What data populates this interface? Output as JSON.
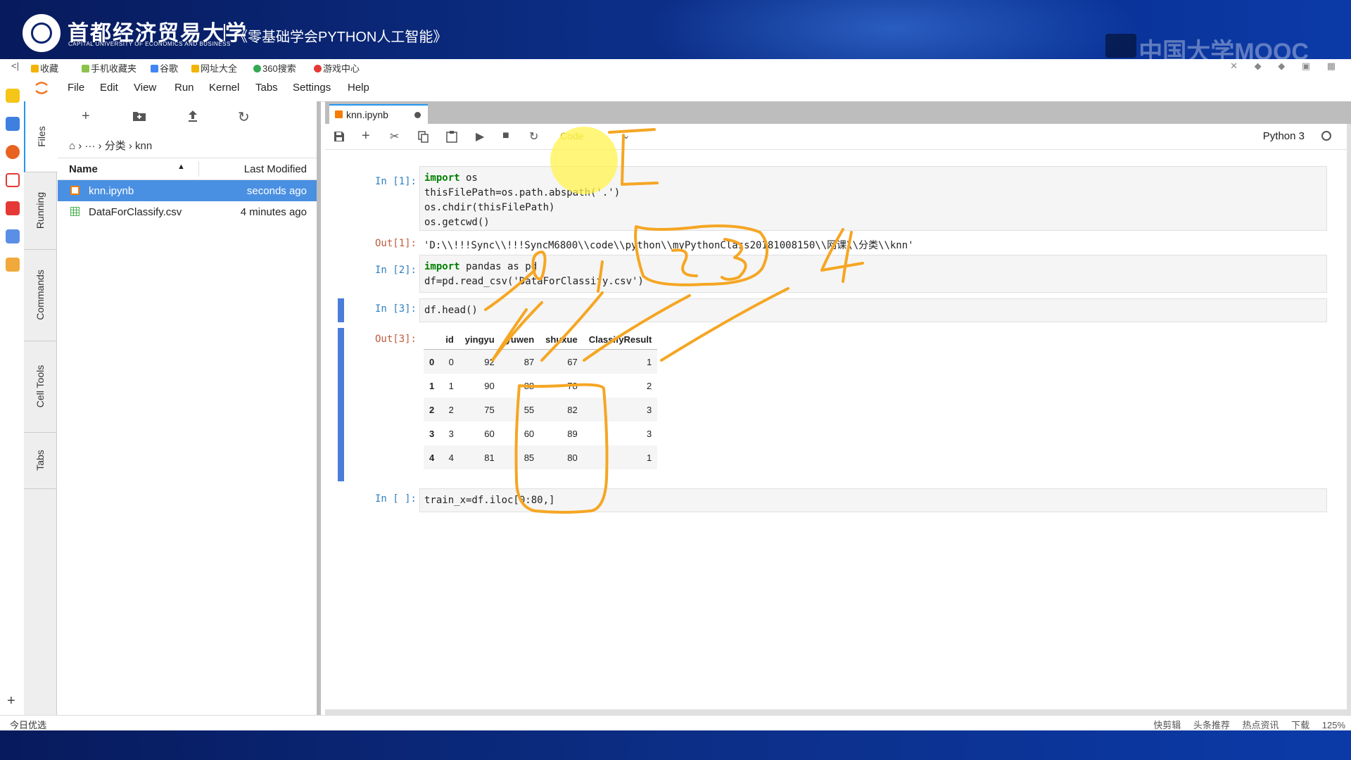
{
  "banner": {
    "university_name": "首都经济贸易大学",
    "university_english": "CAPITAL UNIVERSITY OF ECONOMICS AND BUSINESS",
    "course_title": "《零基础学会PYTHON人工智能》",
    "watermark": "中国大学MOOC"
  },
  "browser": {
    "bookmarks": [
      {
        "label": "收藏",
        "color": "#f2b400"
      },
      {
        "label": "手机收藏夹",
        "color": "#8bc34a"
      },
      {
        "label": "谷歌",
        "color": "#4285f4"
      },
      {
        "label": "网址大全",
        "color": "#f2b400"
      },
      {
        "label": "360搜索",
        "color": "#34a853"
      },
      {
        "label": "游戏中心",
        "color": "#e53935"
      }
    ]
  },
  "menu": [
    "File",
    "Edit",
    "View",
    "Run",
    "Kernel",
    "Tabs",
    "Settings",
    "Help"
  ],
  "side_tabs": [
    "Files",
    "Running",
    "Commands",
    "Cell Tools",
    "Tabs"
  ],
  "file_browser": {
    "breadcrumb": "› ··· › 分类 › knn",
    "columns": {
      "name": "Name",
      "modified": "Last Modified"
    },
    "files": [
      {
        "name": "knn.ipynb",
        "modified": "seconds ago",
        "selected": true,
        "icon": "notebook-icon"
      },
      {
        "name": "DataForClassify.csv",
        "modified": "4 minutes ago",
        "selected": false,
        "icon": "spreadsheet-icon"
      }
    ]
  },
  "notebook": {
    "tab_name": "knn.ipynb",
    "cell_type": "Code",
    "kernel": "Python 3",
    "cells": {
      "c1_prompt": "In [1]:",
      "c1_lines": [
        "import os",
        "thisFilePath=os.path.abspath('.')",
        "os.chdir(thisFilePath)",
        "os.getcwd()"
      ],
      "c1_out_prompt": "Out[1]:",
      "c1_out": "'D:\\\\!!!Sync\\\\!!!SyncM6800\\\\code\\\\python\\\\myPythonClass20181008150\\\\网课\\\\分类\\\\knn'",
      "c2_prompt": "In [2]:",
      "c2_lines": [
        "import pandas as pd",
        "df=pd.read_csv('DataForClassify.csv')"
      ],
      "c3_prompt": "In [3]:",
      "c3_code": "df.head()",
      "c3_out_prompt": "Out[3]:",
      "c4_prompt": "In [ ]:",
      "c4_code": "train_x=df.iloc[0:80,]"
    },
    "dataframe": {
      "columns": [
        "id",
        "yingyu",
        "yuwen",
        "shuxue",
        "ClassifyResult"
      ],
      "rows": [
        {
          "index": "0",
          "values": [
            "0",
            "92",
            "87",
            "67",
            "1"
          ]
        },
        {
          "index": "1",
          "values": [
            "1",
            "90",
            "88",
            "78",
            "2"
          ]
        },
        {
          "index": "2",
          "values": [
            "2",
            "75",
            "55",
            "82",
            "3"
          ]
        },
        {
          "index": "3",
          "values": [
            "3",
            "60",
            "60",
            "89",
            "3"
          ]
        },
        {
          "index": "4",
          "values": [
            "4",
            "81",
            "85",
            "80",
            "1"
          ]
        }
      ]
    }
  },
  "annotations": {
    "labels": [
      "0",
      "1",
      "2",
      "3",
      "4"
    ],
    "color": "#f5a623"
  },
  "statusbar": {
    "left": "今日优选",
    "right": [
      "快剪辑",
      "头条推荐",
      "热点资讯",
      "下载",
      "125%"
    ]
  }
}
